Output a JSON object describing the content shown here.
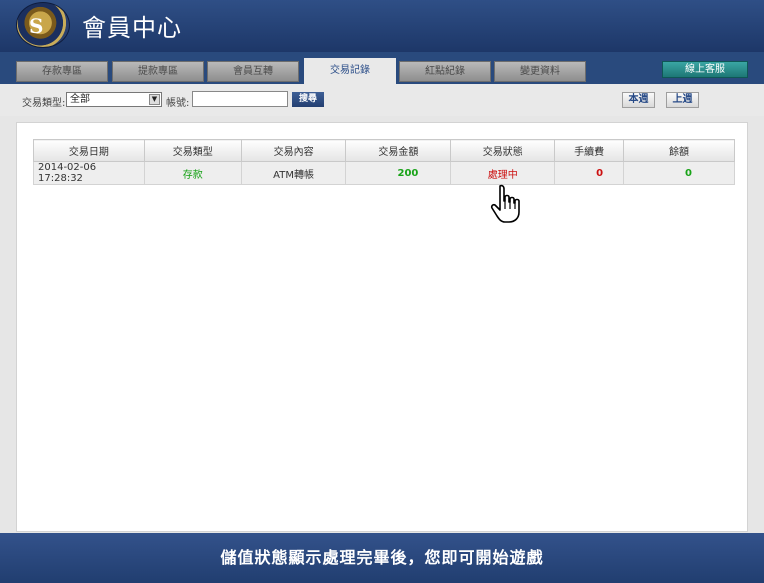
{
  "header": {
    "logo_text": "S",
    "title": "會員中心"
  },
  "tabs": [
    {
      "label": "存款專區"
    },
    {
      "label": "提款專區"
    },
    {
      "label": "會員互轉"
    },
    {
      "label": "交易記錄"
    },
    {
      "label": "紅點紀錄"
    },
    {
      "label": "變更資料"
    }
  ],
  "active_tab_index": 3,
  "online_service_label": "線上客服",
  "filter": {
    "type_label": "交易類型:",
    "type_selected": "全部",
    "account_label": "帳號:",
    "account_value": "",
    "search_label": "搜尋",
    "this_week_label": "本週",
    "last_week_label": "上週"
  },
  "table": {
    "headers": [
      "交易日期",
      "交易類型",
      "交易內容",
      "交易金額",
      "交易狀態",
      "手續費",
      "餘額"
    ],
    "rows": [
      {
        "date": "2014-02-06 17:28:32",
        "type": "存款",
        "content": "ATM轉帳",
        "amount": "200",
        "status": "處理中",
        "fee": "0",
        "balance": "0"
      }
    ]
  },
  "footer_message": "儲值狀態顯示處理完畢後，您即可開始遊戲",
  "colors": {
    "header_bg": "#2f4f86",
    "active_tab": "#e9e9e9",
    "green": "#13a012",
    "red": "#cc1010",
    "online_button": "#2a8f8d"
  }
}
